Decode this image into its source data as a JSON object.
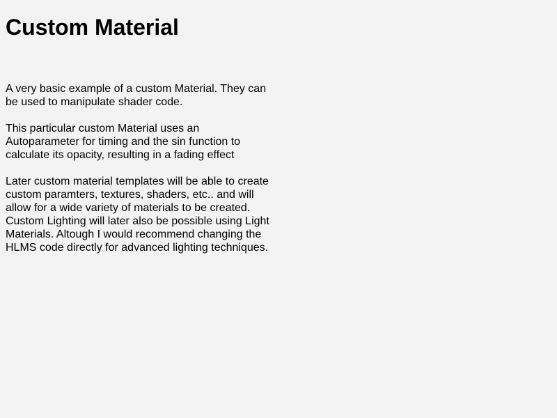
{
  "page": {
    "title": "Custom Material",
    "paragraphs": [
      "A very basic example of a custom Material. They can be used to manipulate shader code.",
      "This particular custom Material uses an Autoparameter for timing and the sin function to calculate its opacity, resulting in a fading effect",
      "Later custom material templates will be able to create custom paramters, textures, shaders, etc.. and will allow for a wide variety of materials to be created. Custom Lighting will later also be possible using Light Materials. Altough I would recommend changing the HLMS code directly for advanced lighting techniques."
    ]
  }
}
